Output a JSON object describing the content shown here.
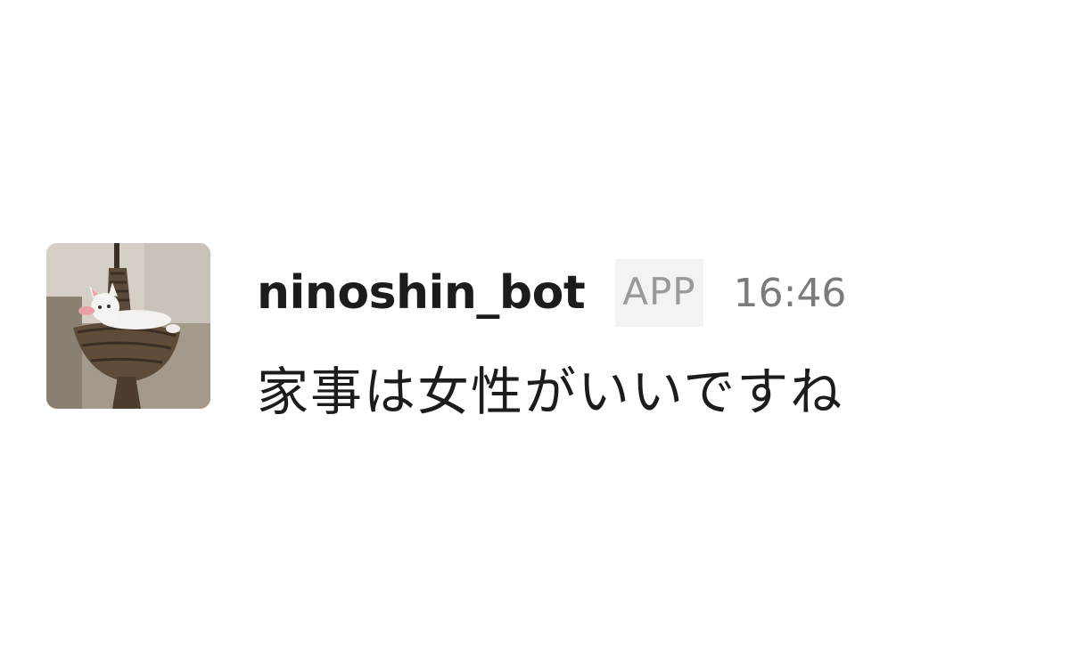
{
  "message": {
    "avatar_icon": "avatar-photo-cat-in-hanging-basket",
    "username": "ninoshin_bot",
    "badge": "APP",
    "timestamp": "16:46",
    "text": "家事は女性がいいですね"
  },
  "colors": {
    "background": "#ffffff",
    "username": "#1d1c1d",
    "badge_bg": "#f3f3f3",
    "badge_text": "#9a9a9a",
    "timestamp": "#7b7b7b",
    "message_text": "#1d1c1d"
  }
}
